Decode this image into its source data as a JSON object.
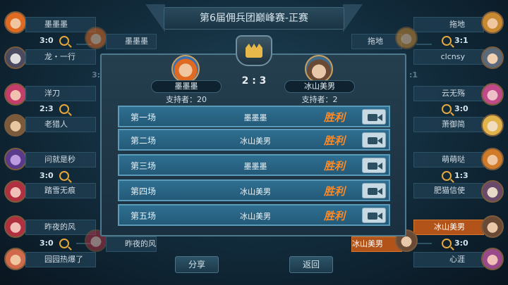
{
  "title": "第6届佣兵团巅峰赛-正赛",
  "bracket": {
    "left": [
      {
        "name": "墨墨墨",
        "score": "3:0",
        "top": true
      },
      {
        "name": "龙・一行"
      },
      {
        "name": "洋刀",
        "score": "2:3"
      },
      {
        "name": "老猎人"
      },
      {
        "name": "问就是秒",
        "score": "3:0"
      },
      {
        "name": "踏雪无痕"
      },
      {
        "name": "昨夜的风",
        "score": "3:0"
      },
      {
        "name": "园园热爆了"
      }
    ],
    "right": [
      {
        "name": "拖地",
        "score": "3:1"
      },
      {
        "name": "clcnsy"
      },
      {
        "name": "云无殇",
        "score": "3:0"
      },
      {
        "name": "萧御简"
      },
      {
        "name": "萌萌哒",
        "score": "1:3"
      },
      {
        "name": "肥猫信使"
      },
      {
        "name": "冰山美男",
        "score": "3:0"
      },
      {
        "name": "心涯"
      }
    ],
    "semis": {
      "left_top": "墨墨墨",
      "left_bottom": "昨夜的风",
      "right_top": "拖地",
      "right_bottom": "冰山美男"
    },
    "side_scores": {
      "left": "3:",
      "right": ":1"
    }
  },
  "match": {
    "player_left": {
      "name": "墨墨墨",
      "supporters": "支持者：20"
    },
    "player_right": {
      "name": "冰山美男",
      "supporters": "支持者：2"
    },
    "score": "2 : 3",
    "rounds": [
      {
        "label": "第一场",
        "winner": "墨墨墨",
        "result": "胜利"
      },
      {
        "label": "第二场",
        "winner": "冰山美男",
        "result": "胜利"
      },
      {
        "label": "第三场",
        "winner": "墨墨墨",
        "result": "胜利"
      },
      {
        "label": "第四场",
        "winner": "冰山美男",
        "result": "胜利"
      },
      {
        "label": "第五场",
        "winner": "冰山美男",
        "result": "胜利"
      }
    ]
  },
  "buttons": {
    "share": "分享",
    "back": "返回"
  },
  "colors": {
    "accent_orange": "#ff8a24",
    "row_blue": "#2f6f91",
    "winner_orange": "#b2531a"
  }
}
